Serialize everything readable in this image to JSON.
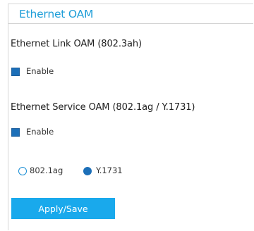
{
  "header": {
    "title": "Ethernet OAM"
  },
  "link_oam": {
    "title": "Ethernet Link OAM (802.3ah)",
    "enable_label": "Enable",
    "enable_checked": true
  },
  "service_oam": {
    "title": "Ethernet Service OAM (802.1ag / Y.1731)",
    "enable_label": "Enable",
    "enable_checked": true,
    "mode_options": [
      "802.1ag",
      "Y.1731"
    ],
    "mode_selected": "Y.1731"
  },
  "actions": {
    "apply_label": "Apply/Save"
  },
  "colors": {
    "accent": "#1f9ed8",
    "button": "#19a9ec",
    "check": "#1c6fb8"
  }
}
